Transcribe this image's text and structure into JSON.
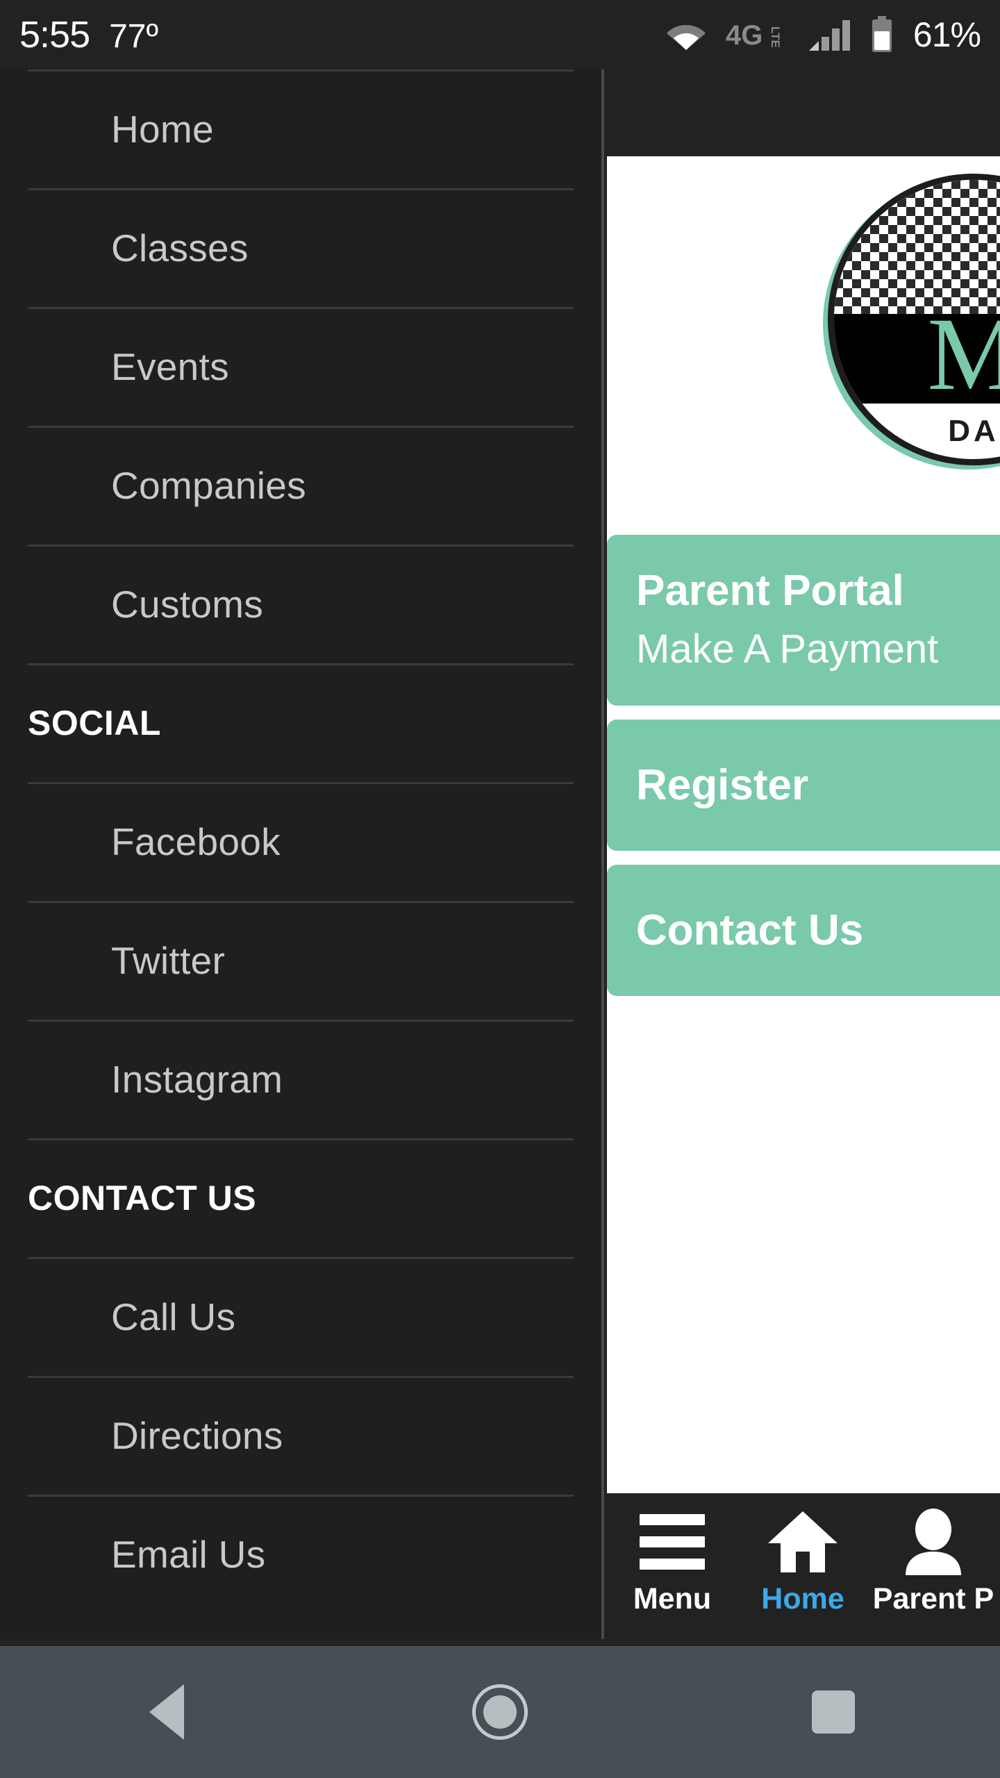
{
  "statusbar": {
    "clock": "5:55",
    "temperature": "77º",
    "battery_percent": "61%",
    "network_label": "4G",
    "network_sub": "LTE",
    "icons": [
      "wifi-icon",
      "lte-icon",
      "cellular-signal-icon",
      "battery-icon"
    ]
  },
  "drawer": {
    "primary_items": [
      {
        "label": "Home"
      },
      {
        "label": "Classes"
      },
      {
        "label": "Events"
      },
      {
        "label": "Companies"
      },
      {
        "label": "Customs"
      }
    ],
    "social_heading": "SOCIAL",
    "social_items": [
      {
        "label": "Facebook"
      },
      {
        "label": "Twitter"
      },
      {
        "label": "Instagram"
      }
    ],
    "contact_heading": "CONTACT US",
    "contact_items": [
      {
        "label": "Call Us"
      },
      {
        "label": "Directions"
      },
      {
        "label": "Email Us"
      }
    ]
  },
  "content": {
    "logo": {
      "letter": "M",
      "subtitle": "DA"
    },
    "buttons": [
      {
        "title": "Parent Portal",
        "subtitle": "Make A Payment"
      },
      {
        "title": "Register",
        "subtitle": ""
      },
      {
        "title": "Contact Us",
        "subtitle": ""
      }
    ]
  },
  "appnav": {
    "items": [
      {
        "label": "Menu",
        "icon": "hamburger-icon",
        "active": false
      },
      {
        "label": "Home",
        "icon": "house-icon",
        "active": true
      },
      {
        "label": "Parent P",
        "icon": "person-icon",
        "active": false
      }
    ]
  },
  "sysnav": {
    "back": "back-button",
    "home": "home-button",
    "recents": "recents-button"
  },
  "colors": {
    "accent_green": "#7ac9aa",
    "active_blue": "#3da8e8",
    "drawer_bg": "#1f1f1f",
    "statusbar_bg": "#222222",
    "sysnav_bg": "#474f54"
  }
}
